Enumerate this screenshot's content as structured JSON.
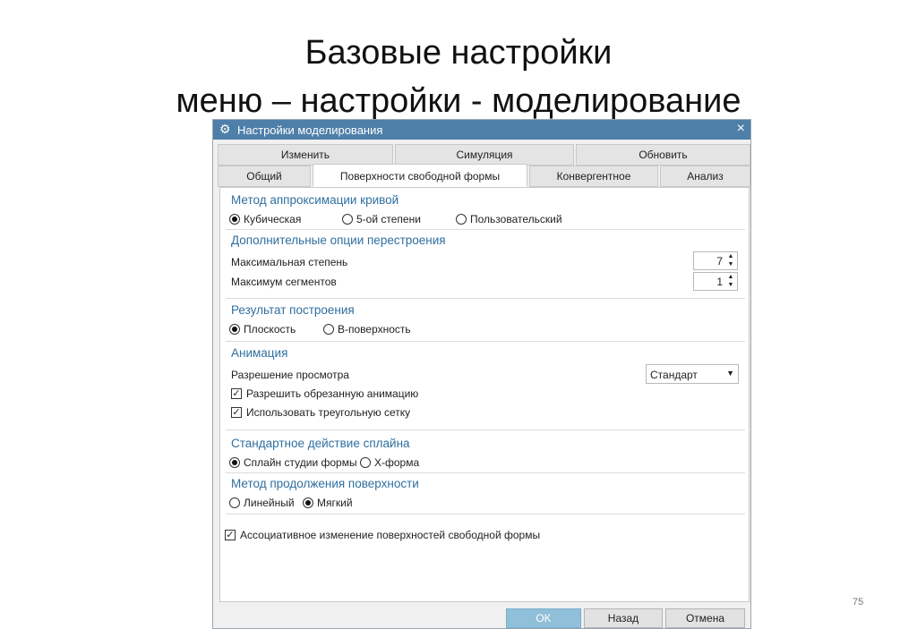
{
  "slide": {
    "title_line1": "Базовые настройки",
    "title_line2": "меню – настройки - моделирование",
    "page_number": "75"
  },
  "dialog": {
    "title": "Настройки моделирования",
    "close_icon": "×",
    "gear_icon": "⚙",
    "tabs_row1": [
      "Изменить",
      "Симуляция",
      "Обновить"
    ],
    "tabs_row2": [
      "Общий",
      "Поверхности свободной формы",
      "Конвергентное",
      "Анализ"
    ],
    "active_tab": "Поверхности свободной формы",
    "sections": {
      "approx": {
        "title": "Метод аппроксимации  кривой",
        "options": [
          "Кубическая",
          "5-ой степени",
          "Пользовательский"
        ],
        "selected": "Кубическая"
      },
      "rebuild": {
        "title": "Дополнительные опции перестроения",
        "max_degree_label": "Максимальная степень",
        "max_degree_value": "7",
        "max_segments_label": "Максимум сегментов",
        "max_segments_value": "1"
      },
      "result": {
        "title": "Результат построения",
        "options": [
          "Плоскость",
          "B-поверхность"
        ],
        "selected": "Плоскость"
      },
      "animation": {
        "title": "Анимация",
        "preview_label": "Разрешение просмотра",
        "preview_value": "Стандарт",
        "allow_trimmed_label": "Разрешить обрезанную анимацию",
        "allow_trimmed_checked": true,
        "use_triangle_label": "Использовать треугольную сетку",
        "use_triangle_checked": true
      },
      "spline": {
        "title": "Стандартное действие сплайна",
        "options": [
          "Сплайн студии формы",
          "X-форма"
        ],
        "selected": "Сплайн студии формы"
      },
      "continuation": {
        "title": "Метод продолжения поверхности",
        "options": [
          "Линейный",
          "Мягкий"
        ],
        "selected": "Мягкий"
      },
      "associative_label": "Ассоциативное изменение поверхностей свободной формы",
      "associative_checked": true
    },
    "buttons": {
      "ok": "OK",
      "back": "Назад",
      "cancel": "Отмена"
    }
  }
}
